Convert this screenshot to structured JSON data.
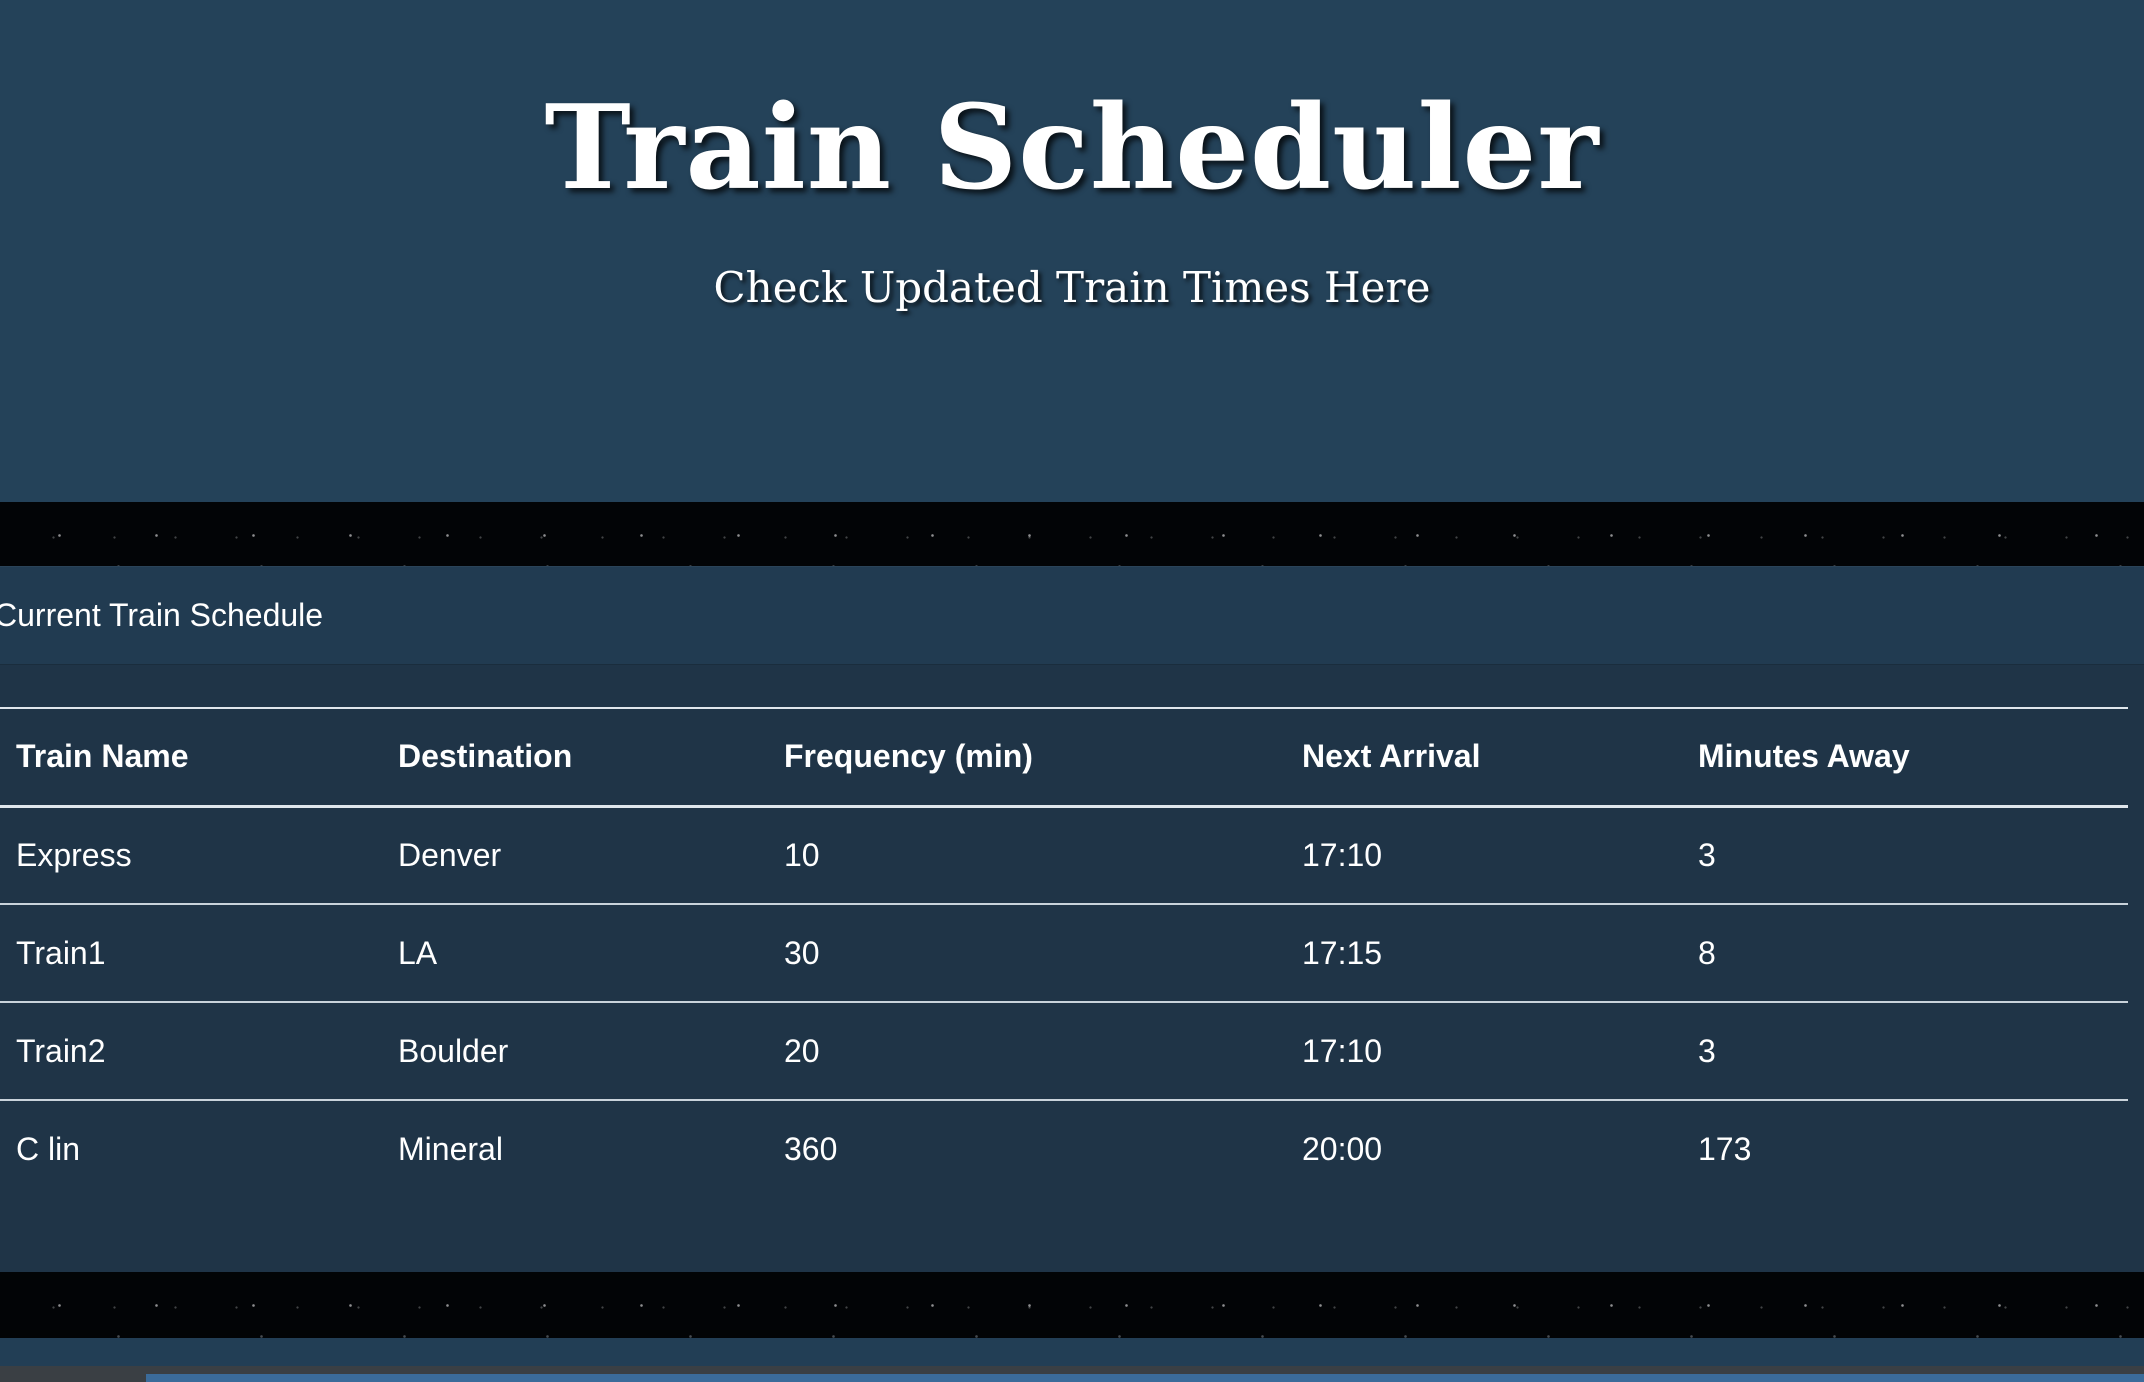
{
  "header": {
    "title": "Train Scheduler",
    "subtitle": "Check Updated Train Times Here"
  },
  "schedule": {
    "title": "Current Train Schedule",
    "columns": [
      "Train Name",
      "Destination",
      "Frequency (min)",
      "Next Arrival",
      "Minutes Away"
    ],
    "rows": [
      [
        "Express",
        "Denver",
        "10",
        "17:10",
        "3"
      ],
      [
        "Train1",
        "LA",
        "30",
        "17:15",
        "8"
      ],
      [
        "Train2",
        "Boulder",
        "20",
        "17:10",
        "3"
      ],
      [
        "C lin",
        "Mineral",
        "360",
        "20:00",
        "173"
      ]
    ]
  },
  "colors": {
    "hero_bg": "#244259",
    "card_bg": "#1f3447",
    "text": "#ffffff"
  }
}
